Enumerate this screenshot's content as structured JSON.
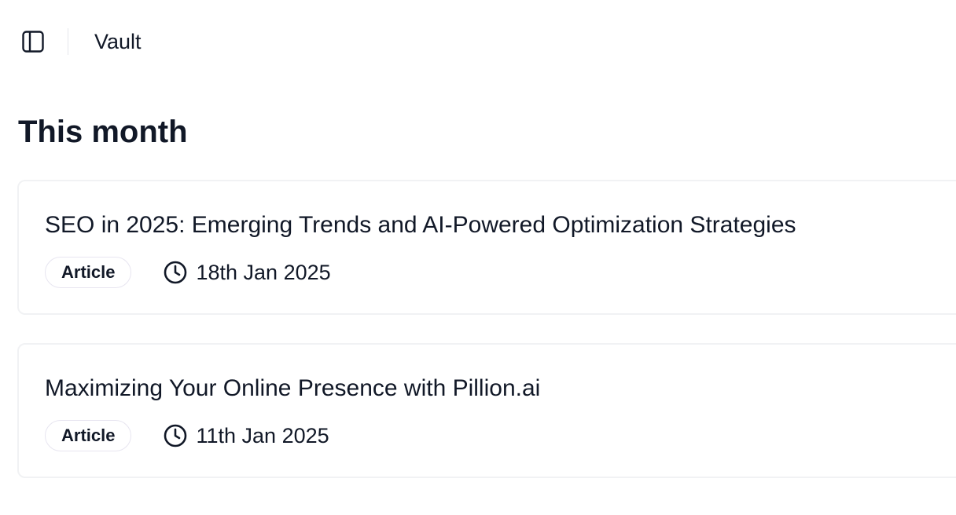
{
  "header": {
    "breadcrumb": "Vault",
    "sidebar_toggle_icon": "sidebar-panel-icon"
  },
  "section": {
    "title": "This month"
  },
  "items": [
    {
      "title": "SEO in 2025: Emerging Trends and AI-Powered Optimization Strategies",
      "type": "Article",
      "date": "18th Jan 2025",
      "date_icon": "clock-icon"
    },
    {
      "title": "Maximizing Your Online Presence with Pillion.ai",
      "type": "Article",
      "date": "11th Jan 2025",
      "date_icon": "clock-icon"
    }
  ],
  "colors": {
    "text": "#111827",
    "border": "#f1f2f4",
    "badge_border": "#e7e5f0"
  }
}
